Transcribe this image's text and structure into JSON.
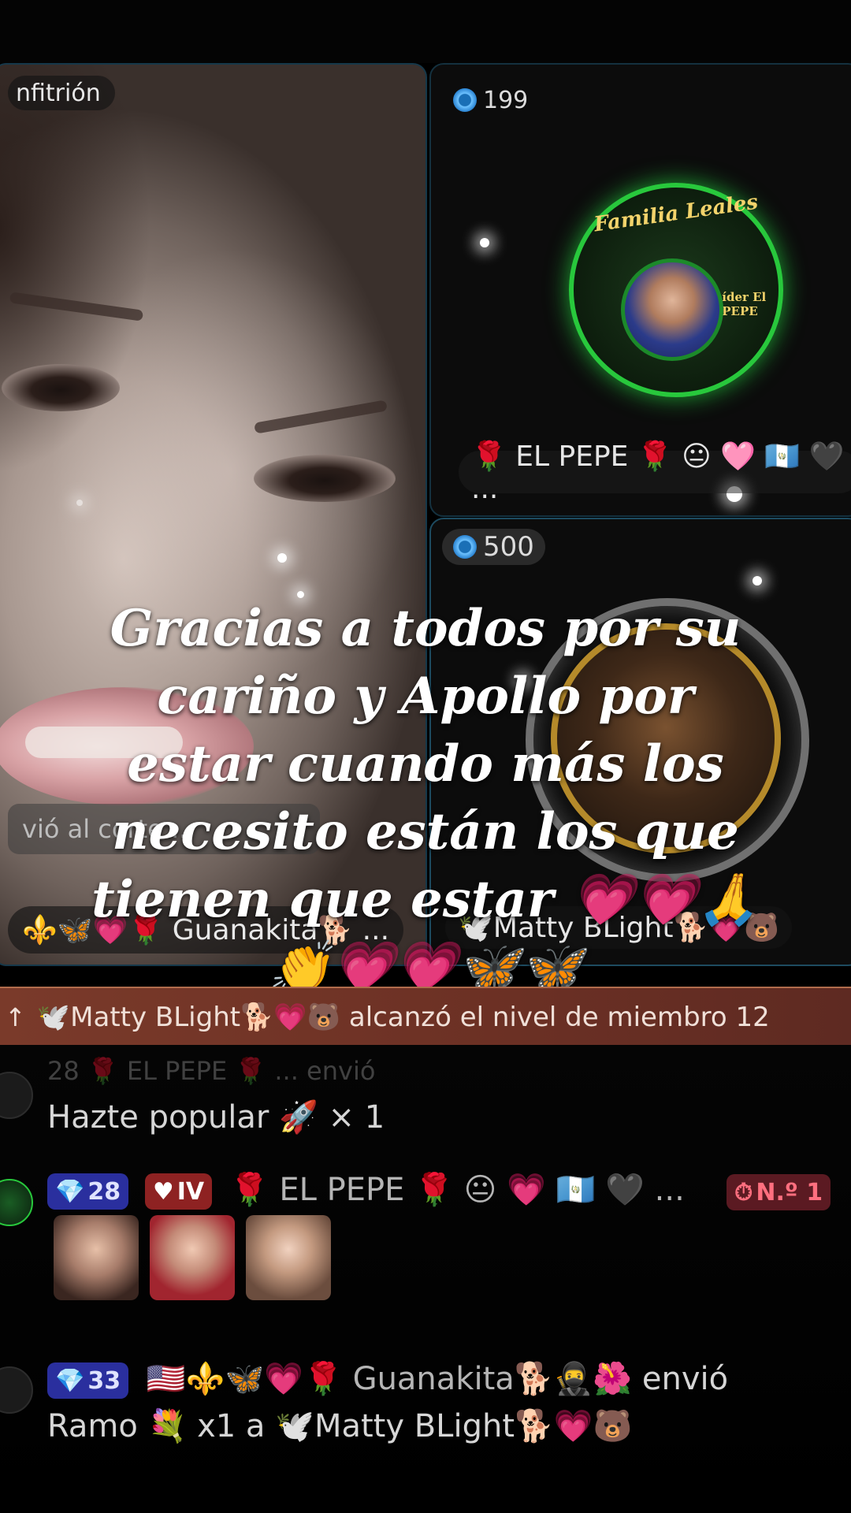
{
  "host": {
    "role_label": "nfitrión",
    "comment_preview": "vió al corte...",
    "name_label": "⚜️🦋💗🌹 Guanakita🐕 ..."
  },
  "guests": [
    {
      "score": "199",
      "ring_title": "Familia Leales",
      "ring_subtitle": "Líder El PEPE",
      "name_label": "🌹 EL PEPE 🌹 😐 🩷 🇬🇹 🖤 ..."
    },
    {
      "score": "500",
      "name_label": "🕊️Matty BLight🐕💗🐻"
    }
  ],
  "overlay_text": "Gracias a todos por su cariño y Apollo por estar cuando más los necesito están los que tienen que estar 💗💗🙏👏💗💗🦋🦋",
  "level_banner": {
    "arrow": "↑",
    "text": "🕊️Matty BLight🐕💗🐻 alcanzó el nivel de miembro 12"
  },
  "chat": {
    "row0": {
      "header_faded": "28 🌹 EL PEPE 🌹 ... envió",
      "message": "Hazte popular 🚀 × 1"
    },
    "row1": {
      "gem_level": "28",
      "fan_badge": "IV",
      "user": "🌹 EL PEPE 🌹 😐 💗 🇬🇹 🖤 ...",
      "rank": "N.º 1"
    },
    "row2": {
      "gem_level": "33",
      "user": "🇺🇸⚜️🦋💗🌹 Guanakita🐕🥷🌺",
      "action": "envió",
      "message": "Ramo 💐 x1 a 🕊️Matty BLight🐕💗🐻"
    }
  },
  "colors": {
    "guest_ring": "#28c83c",
    "banner": "#7a3a2a",
    "gem_badge": "#2a2f9e",
    "rank_badge": "#5b1a22"
  }
}
